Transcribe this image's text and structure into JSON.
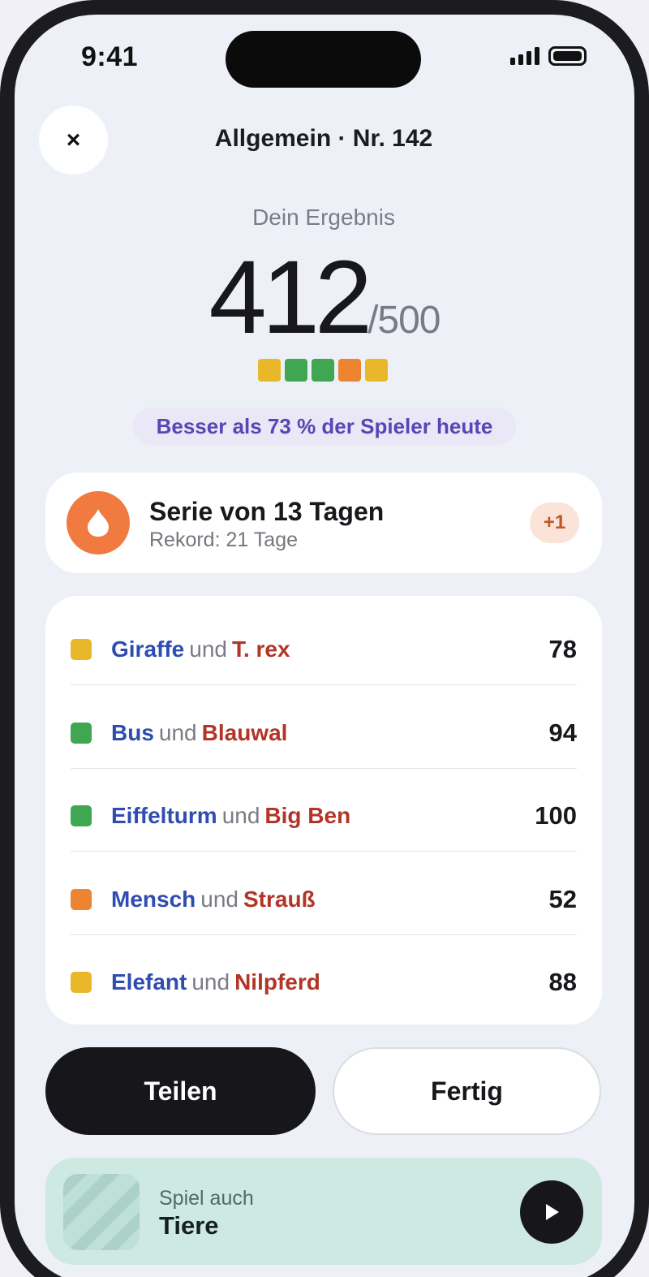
{
  "status_bar": {
    "time": "9:41"
  },
  "header": {
    "close_label": "×",
    "title": "Allgemein · Nr. 142"
  },
  "result": {
    "label": "Dein Ergebnis",
    "score": "412",
    "total": "/500",
    "round_colors": [
      "#e9b82a",
      "#3fa651",
      "#3fa651",
      "#ed8431",
      "#e9b82a"
    ],
    "percentile_text": "Besser als 73 % der Spieler heute"
  },
  "streak": {
    "title": "Serie von 13 Tagen",
    "record": "Rekord: 21 Tage",
    "badge": "+1",
    "icon": "flame-icon"
  },
  "rounds": [
    {
      "a": "Giraffe",
      "und": "und",
      "b": "T. rex",
      "score": "78",
      "color": "#e9b82a"
    },
    {
      "a": "Bus",
      "und": "und",
      "b": "Blauwal",
      "score": "94",
      "color": "#3fa651"
    },
    {
      "a": "Eiffelturm",
      "und": "und",
      "b": "Big Ben",
      "score": "100",
      "color": "#3fa651"
    },
    {
      "a": "Mensch",
      "und": "und",
      "b": "Strauß",
      "score": "52",
      "color": "#ed8431"
    },
    {
      "a": "Elefant",
      "und": "und",
      "b": "Nilpferd",
      "score": "88",
      "color": "#e9b82a"
    }
  ],
  "actions": {
    "share": "Teilen",
    "done": "Fertig"
  },
  "promo": {
    "pre": "Spiel auch",
    "title": "Tiere"
  }
}
